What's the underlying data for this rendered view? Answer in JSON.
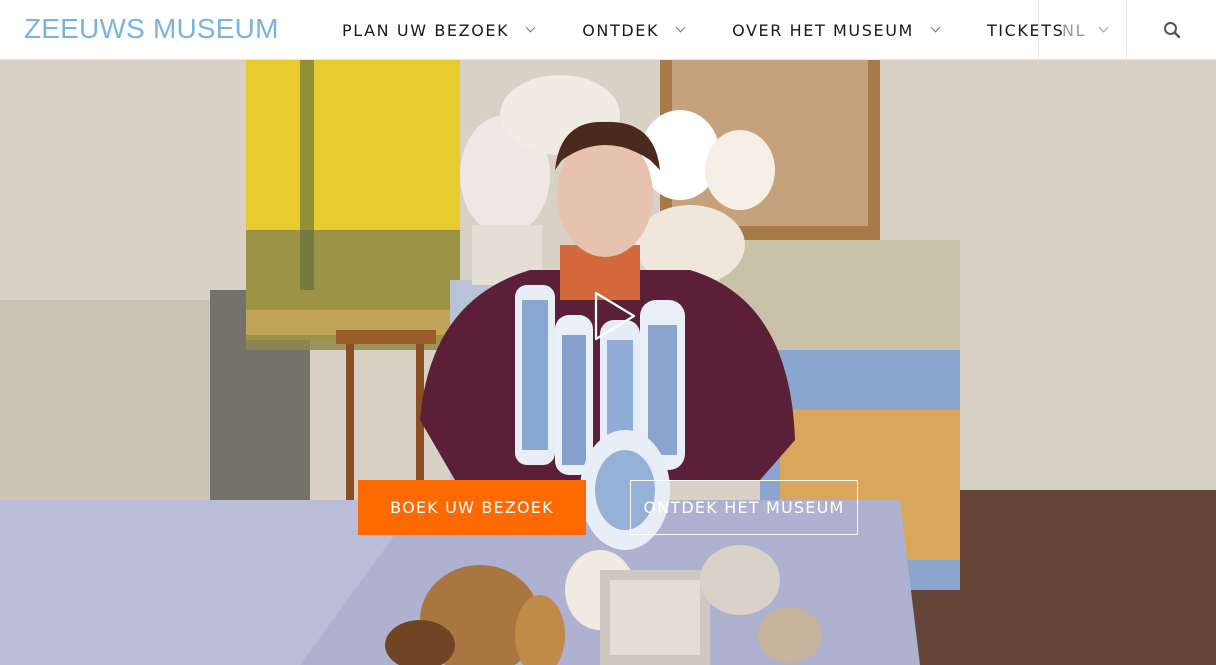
{
  "header": {
    "logo": "ZEEUWS MUSEUM",
    "nav": [
      {
        "label": "PLAN UW BEZOEK",
        "has_dropdown": true
      },
      {
        "label": "ONTDEK",
        "has_dropdown": true
      },
      {
        "label": "OVER HET MUSEUM",
        "has_dropdown": true
      },
      {
        "label": "TICKETS",
        "has_dropdown": false
      }
    ],
    "language": "NL",
    "search_icon": "search-icon"
  },
  "hero": {
    "play_icon": "play-icon",
    "buttons": {
      "primary": "BOEK UW BEZOEK",
      "secondary": "ONTDEK HET MUSEUM"
    }
  },
  "colors": {
    "brand_blue": "#7ab3e0",
    "cta_orange": "#ff6a00",
    "nav_text": "#1a1a1a"
  }
}
